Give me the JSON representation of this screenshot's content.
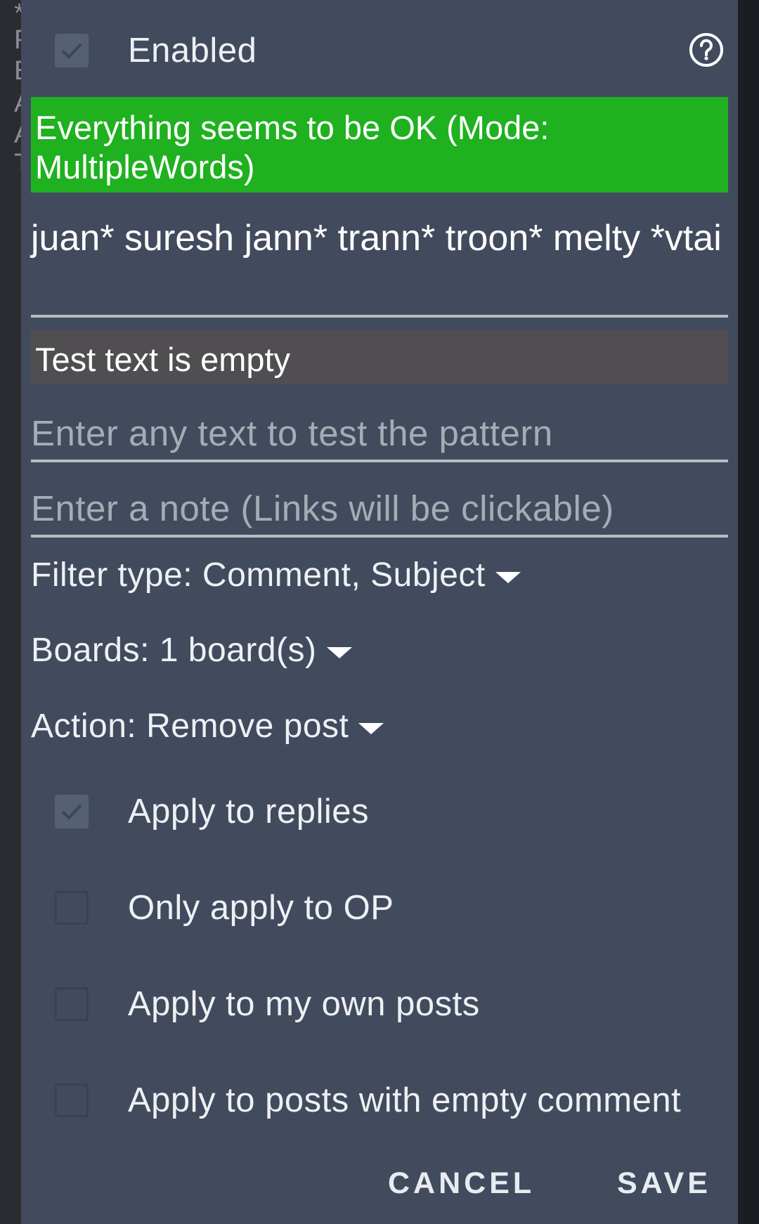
{
  "background": {
    "chars": [
      "*",
      "F",
      "E",
      "A",
      "A",
      "T"
    ]
  },
  "dialog": {
    "enabled": {
      "label": "Enabled",
      "checked": true
    },
    "help_icon": "help-circle-icon",
    "pattern_status": {
      "text": "Everything seems to be OK (Mode: MultipleWords)",
      "color": "#1fb11f"
    },
    "pattern": "juan* suresh jann* trann* troon* melty *vtai",
    "test_status": {
      "text": "Test text is empty"
    },
    "test_input": {
      "value": "",
      "placeholder": "Enter any text to test the pattern"
    },
    "note_input": {
      "value": "",
      "placeholder": "Enter a note (Links will be clickable)"
    },
    "filter_type": "Filter type: Comment, Subject",
    "boards": "Boards: 1 board(s)",
    "action": "Action: Remove post",
    "options": [
      {
        "label": "Apply to replies",
        "checked": true
      },
      {
        "label": "Only apply to OP",
        "checked": false
      },
      {
        "label": "Apply to my own posts",
        "checked": false
      },
      {
        "label": "Apply to posts with empty comment",
        "checked": false
      }
    ],
    "buttons": {
      "cancel": "CANCEL",
      "save": "SAVE"
    }
  }
}
